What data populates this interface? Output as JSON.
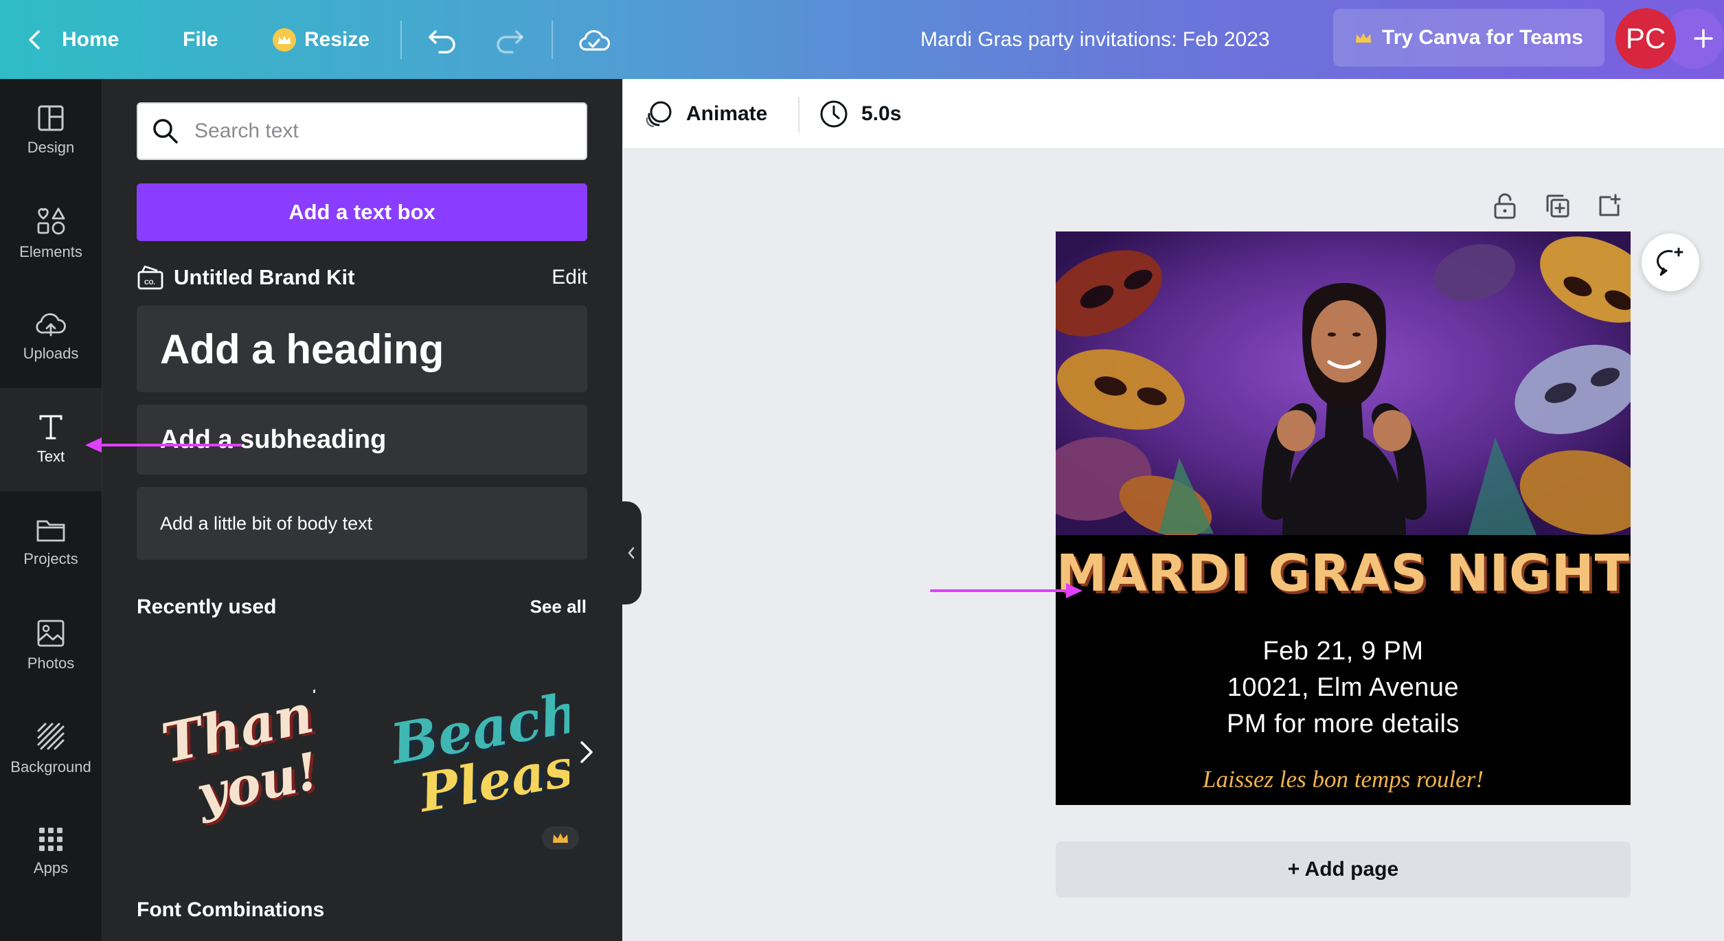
{
  "topbar": {
    "home_label": "Home",
    "file_label": "File",
    "resize_label": "Resize",
    "doc_title": "Mardi Gras party invitations: Feb 2023",
    "teams_label": "Try Canva for Teams",
    "avatar_initials": "PC"
  },
  "rail": {
    "items": [
      {
        "label": "Design",
        "icon": "layout-icon"
      },
      {
        "label": "Elements",
        "icon": "shapes-icon"
      },
      {
        "label": "Uploads",
        "icon": "cloud-upload-icon"
      },
      {
        "label": "Text",
        "icon": "text-icon"
      },
      {
        "label": "Projects",
        "icon": "folder-icon"
      },
      {
        "label": "Photos",
        "icon": "image-icon"
      },
      {
        "label": "Background",
        "icon": "pattern-icon"
      },
      {
        "label": "Apps",
        "icon": "grid-icon"
      }
    ],
    "active": "Text"
  },
  "panel": {
    "search_placeholder": "Search text",
    "add_text_box": "Add a text box",
    "brand_kit": "Untitled Brand Kit",
    "brand_edit": "Edit",
    "heading": "Add a heading",
    "subheading": "Add a subheading",
    "body": "Add a little bit of body text",
    "recently_used": "Recently used",
    "see_all": "See all",
    "stickers": [
      {
        "line1": "Thank",
        "line2": "you!"
      },
      {
        "line1": "Beach",
        "line2": "Please"
      }
    ],
    "font_combinations": "Font Combinations"
  },
  "toolbar": {
    "animate": "Animate",
    "duration": "5.0s"
  },
  "design": {
    "title": "MARDI GRAS NIGHT",
    "line1": "Feb 21, 9 PM",
    "line2": "10021, Elm Avenue",
    "line3": "PM for more details",
    "tagline": "Laissez les bon temps rouler!"
  },
  "add_page": "+ Add page",
  "colors": {
    "accent_purple": "#8b3dff",
    "annotation_arrow": "#e040fb",
    "title_gold": "#f5c27a",
    "avatar_red": "#d7263d"
  }
}
